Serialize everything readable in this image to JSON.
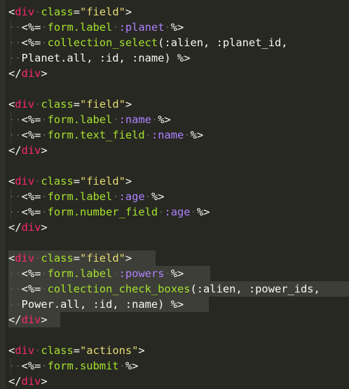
{
  "editor": {
    "blocks": [
      {
        "open": {
          "tag": "div",
          "attr": "class",
          "value": "\"field\""
        },
        "lines": [
          {
            "erb": "<%=",
            "method": "form.label",
            "args": ":planet",
            "close": "%>"
          },
          {
            "erb": "<%=",
            "method": "collection_select",
            "args": "(:alien, :planet_id,",
            "close": ""
          },
          {
            "cont": "Planet.all, :id, :name) %>"
          }
        ],
        "close": "div"
      },
      {
        "open": {
          "tag": "div",
          "attr": "class",
          "value": "\"field\""
        },
        "lines": [
          {
            "erb": "<%=",
            "method": "form.label",
            "args": ":name",
            "close": "%>"
          },
          {
            "erb": "<%=",
            "method": "form.text_field",
            "args": ":name",
            "close": "%>"
          }
        ],
        "close": "div"
      },
      {
        "open": {
          "tag": "div",
          "attr": "class",
          "value": "\"field\""
        },
        "lines": [
          {
            "erb": "<%=",
            "method": "form.label",
            "args": ":age",
            "close": "%>"
          },
          {
            "erb": "<%=",
            "method": "form.number_field",
            "args": ":age",
            "close": "%>"
          }
        ],
        "close": "div"
      },
      {
        "open": {
          "tag": "div",
          "attr": "class",
          "value": "\"field\""
        },
        "lines": [
          {
            "erb": "<%=",
            "method": "form.label",
            "args": ":powers",
            "close": "%>"
          },
          {
            "erb": "<%=",
            "method": "collection_check_boxes",
            "args": "(:alien, :power_ids,",
            "close": ""
          },
          {
            "cont": "Power.all, :id, :name) %>"
          }
        ],
        "close": "div"
      },
      {
        "open": {
          "tag": "div",
          "attr": "class",
          "value": "\"actions\""
        },
        "lines": [
          {
            "erb": "<%=",
            "method": "form.submit",
            "args": "",
            "close": "%>"
          }
        ],
        "close": "div"
      }
    ],
    "colors": {
      "background": "#272822",
      "tag": "#f92672",
      "attribute": "#a6e22e",
      "string": "#e6db74",
      "symbol": "#ae81ff",
      "paren": "#fd971f",
      "selection": "#3d3e37"
    }
  }
}
